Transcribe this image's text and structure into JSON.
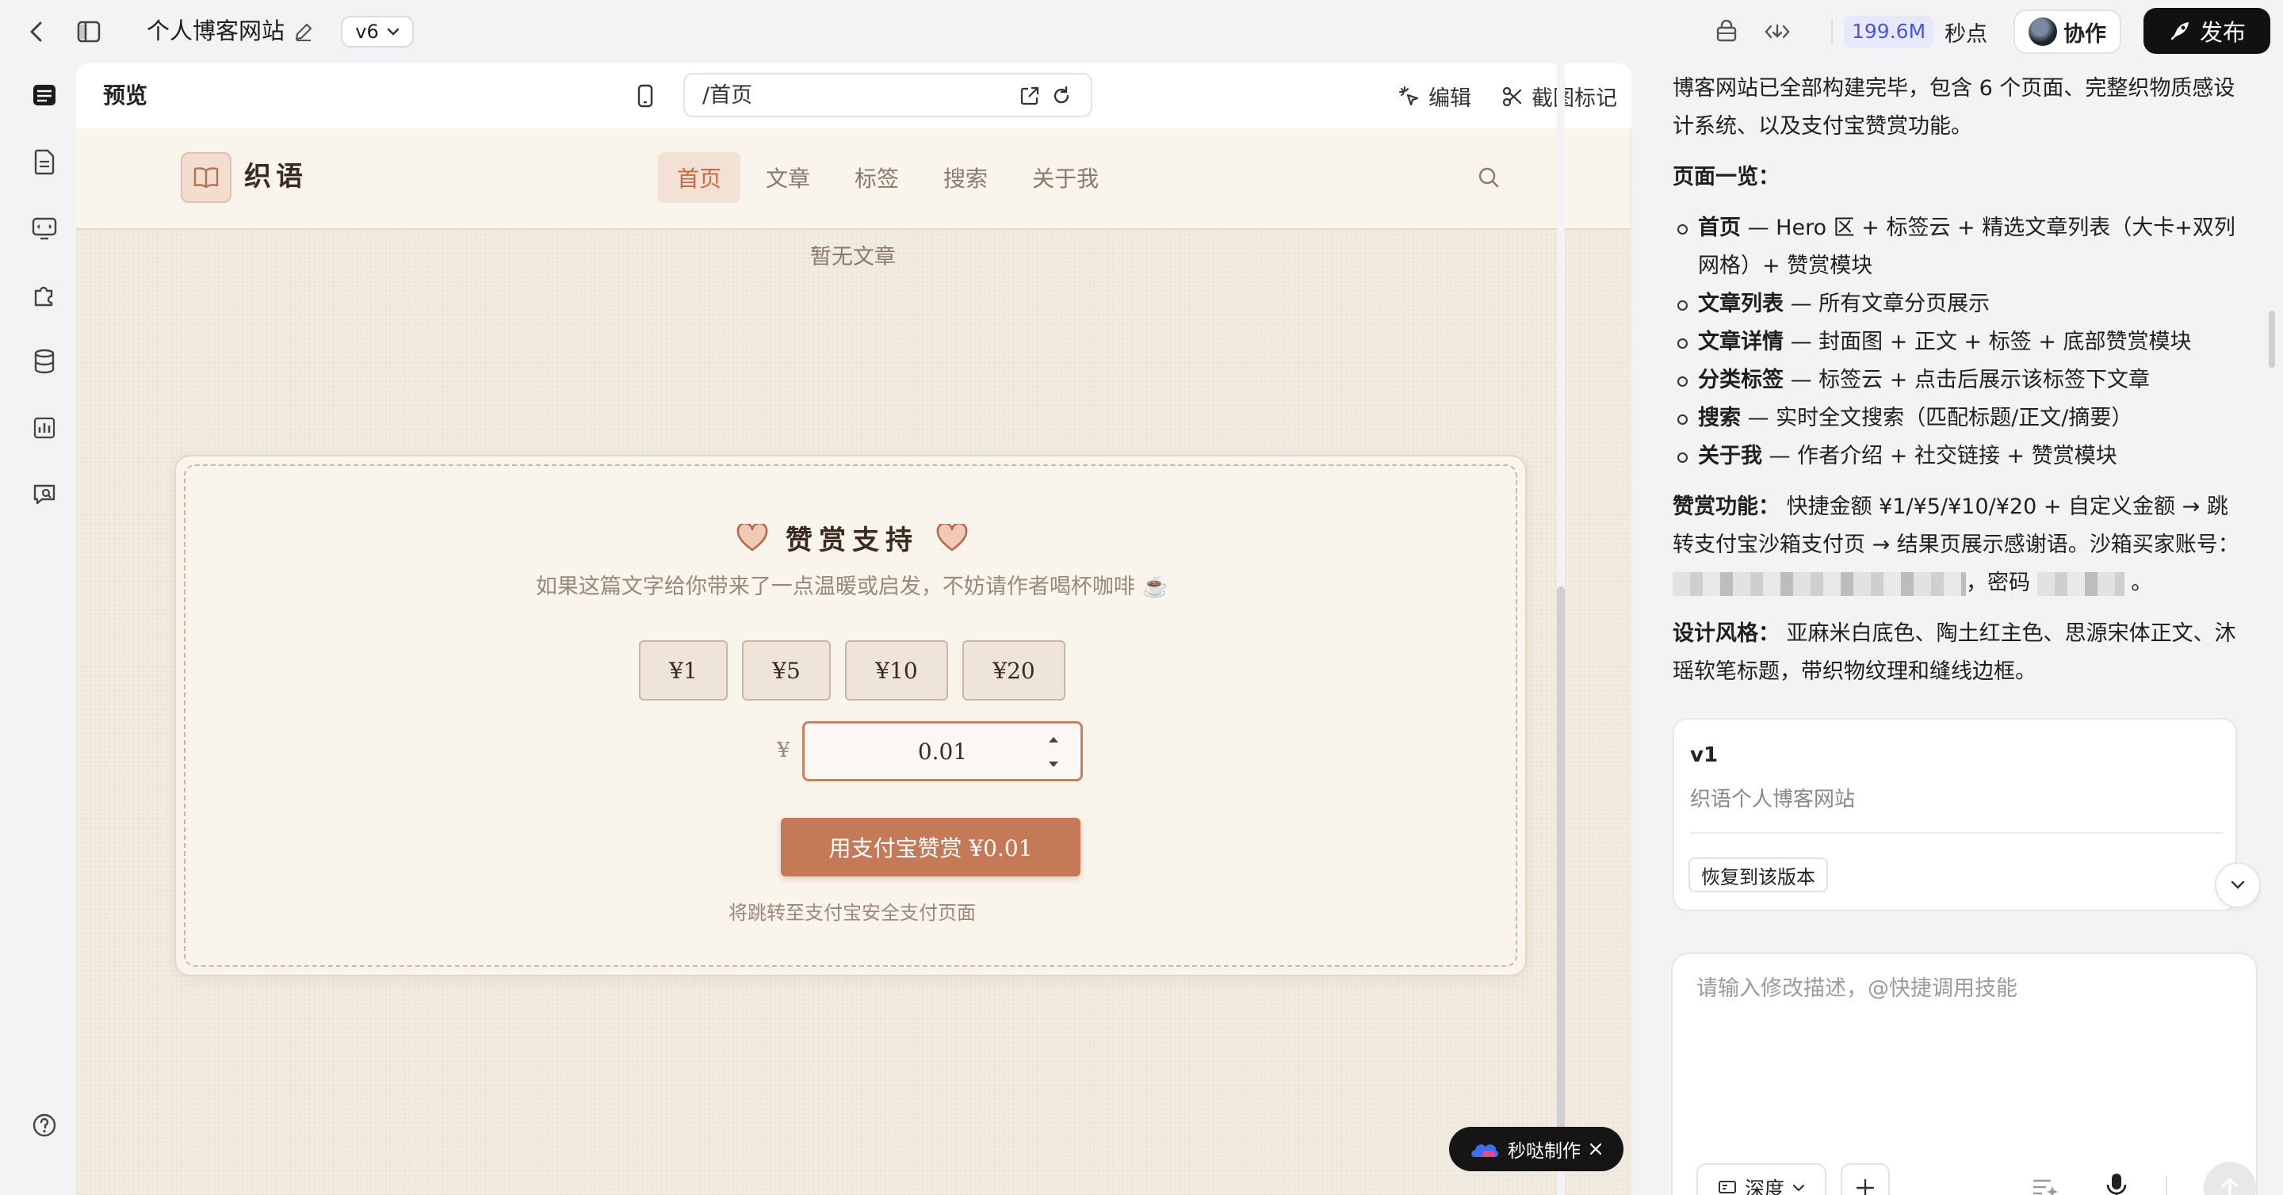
{
  "topbar": {
    "title": "个人博客网站",
    "version": "v6",
    "credits_value": "199.6M",
    "credits_unit": "秒点",
    "collab_label": "协作",
    "publish_label": "发布"
  },
  "preview": {
    "label": "预览",
    "url": "/首页",
    "edit_label": "编辑",
    "screenshot_label": "截图标记"
  },
  "site": {
    "logo_text": "织语",
    "nav": [
      "首页",
      "文章",
      "标签",
      "搜索",
      "关于我"
    ],
    "active_nav": "首页",
    "empty_note": "暂无文章",
    "tip": {
      "title": "赞赏支持",
      "description": "如果这篇文字给你带来了一点温暖或启发，不妨请作者喝杯咖啡 ☕",
      "amounts": [
        "¥1",
        "¥5",
        "¥10",
        "¥20"
      ],
      "currency": "¥",
      "custom_value": "0.01",
      "pay_button": "用支付宝赞赏 ¥0.01",
      "pay_note": "将跳转至支付宝安全支付页面"
    }
  },
  "badge": {
    "label": "秒哒制作"
  },
  "chat": {
    "intro": "博客网站已全部构建完毕，包含 6 个页面、完整织物质感设计系统、以及支付宝赞赏功能。",
    "pages_heading": "页面一览：",
    "pages": [
      {
        "name": "首页",
        "desc": " — Hero 区 + 标签云 + 精选文章列表（大卡+双列网格）+ 赞赏模块"
      },
      {
        "name": "文章列表",
        "desc": " — 所有文章分页展示"
      },
      {
        "name": "文章详情",
        "desc": " — 封面图 + 正文 + 标签 + 底部赞赏模块"
      },
      {
        "name": "分类标签",
        "desc": " — 标签云 + 点击后展示该标签下文章"
      },
      {
        "name": "搜索",
        "desc": " — 实时全文搜索（匹配标题/正文/摘要）"
      },
      {
        "name": "关于我",
        "desc": " — 作者介绍 + 社交链接 + 赞赏模块"
      }
    ],
    "tip_heading": "赞赏功能：",
    "tip_text_1": "快捷金额 ¥1/¥5/¥10/¥20 + 自定义金额 → 跳转支付宝沙箱支付页 → 结果页展示感谢语。沙箱买家账号：",
    "tip_text_2": "，密码",
    "tip_text_3": "。",
    "style_heading": "设计风格：",
    "style_text": "亚麻米白底色、陶土红主色、思源宋体正文、沐瑶软笔标题，带织物纹理和缝线边框。",
    "version_card": {
      "title": "v1",
      "subtitle": "织语个人博客网站",
      "restore_label": "恢复到该版本"
    },
    "composer": {
      "placeholder": "请输入修改描述，@快捷调用技能",
      "depth_label": "深度"
    }
  },
  "colors": {
    "accent": "#c47a57",
    "paper": "#f1ebe0",
    "brand_dark": "#111111",
    "credits_blue": "#4b56d6"
  },
  "icons": [
    "back-icon",
    "sidebar-toggle-icon",
    "edit-pencil-icon",
    "chevron-down-icon",
    "bag-icon",
    "code-diff-icon",
    "rocket-icon",
    "layers-icon",
    "document-icon",
    "monitor-icon",
    "puzzle-icon",
    "database-icon",
    "bar-chart-icon",
    "chat-search-icon",
    "help-icon",
    "phone-icon",
    "external-link-icon",
    "refresh-icon",
    "cursor-sparkle-icon",
    "scissors-icon",
    "book-icon",
    "search-icon",
    "heart-icon",
    "close-icon",
    "plus-icon",
    "list-sparkle-icon",
    "mic-icon",
    "arrow-up-icon",
    "cloud-logo-icon"
  ]
}
